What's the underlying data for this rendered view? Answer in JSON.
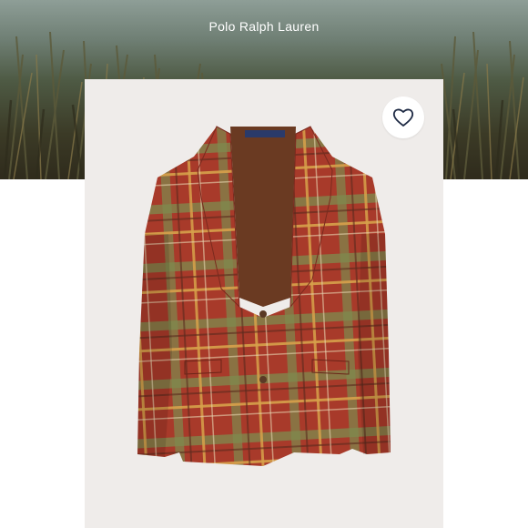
{
  "header": {
    "brand": "Polo Ralph Lauren"
  },
  "product": {
    "image_alt": "red plaid tweed sport coat",
    "favorite_icon": "heart-outline-icon"
  },
  "colors": {
    "card_background": "#efecea",
    "jacket_base": "#a83a2a",
    "plaid_green": "#7d8a4d",
    "plaid_gold": "#d7a14a",
    "lining": "#6a3a22"
  }
}
